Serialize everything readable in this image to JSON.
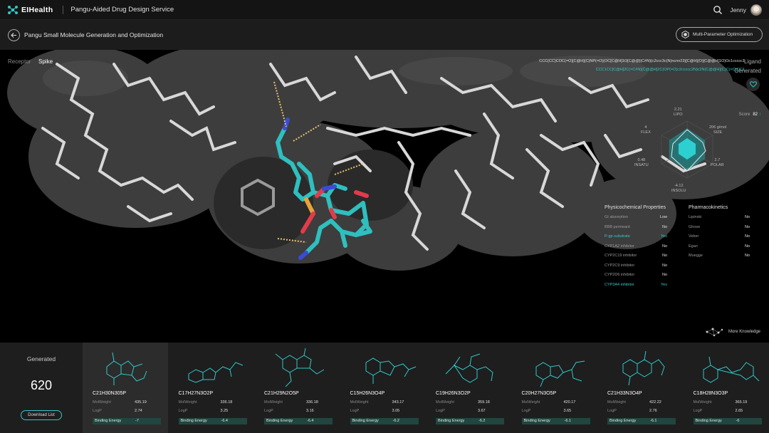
{
  "app": {
    "brand": "EIHealth",
    "service": "Pangu-Aided Drug Design Service",
    "user": "Jenny"
  },
  "header": {
    "title": "Pangu Small Molecule Generation and Optimization",
    "mpo_button": "Multi-Parameter Optimization"
  },
  "viewer": {
    "receptor_label": "Receptor",
    "receptor_value": "Spike",
    "ligand_label": "Ligand",
    "generated_label": "Generated",
    "smiles_ligand": "CCC(CC)COC(=O)[C@H](C)NP(=O)(OC[C@H]1O[C@@](C#N)(c2ccc3c(N)ncnn23)[C@H](O)[C@@H]1O)Oc1ccccc1",
    "smiles_generated": "CCC1CC[C@H]2C(=C#N)[C@@H]2C(OP(=O)c2ccccc2N)c2N(C@@H](C)C)=O)OC1",
    "score_label": "Score",
    "score_value": "82",
    "more_knowledge": "More Knowledge"
  },
  "radar": {
    "lipo": {
      "value": "2.21",
      "label": "LIPO"
    },
    "size": {
      "value": "206 g/mol",
      "label": "SIZE"
    },
    "polar": {
      "value": "2.7",
      "label": "POLAR"
    },
    "insolu": {
      "value": "-4.12",
      "label": "INSOLU"
    },
    "insatu": {
      "value": "0.48",
      "label": "INSATU"
    },
    "flex": {
      "value": "4",
      "label": "FLEX"
    },
    "colors": {
      "accent": "#33c7c7",
      "fill": "#1a8f8f"
    }
  },
  "physicochemical": {
    "title": "Physicochemical Properties",
    "rows": [
      {
        "label": "GI absorption",
        "value": "Low",
        "highlight": false
      },
      {
        "label": "BBB permeant",
        "value": "No",
        "highlight": false
      },
      {
        "label": "P-gp substrate",
        "value": "Yes",
        "highlight": true
      },
      {
        "label": "CYP1A2 inhibitor",
        "value": "No",
        "highlight": false
      },
      {
        "label": "CYP2C19 inhibitor",
        "value": "No",
        "highlight": false
      },
      {
        "label": "CYP2C9 inhibitor",
        "value": "No",
        "highlight": false
      },
      {
        "label": "CYP2D6 inhibitor",
        "value": "No",
        "highlight": false
      },
      {
        "label": "CYP3A4 inhibitor",
        "value": "Yes",
        "highlight": true
      }
    ]
  },
  "pharmacokinetics": {
    "title": "Pharmacokinetics",
    "rows": [
      {
        "label": "Lipinski",
        "value": "No"
      },
      {
        "label": "Ghose",
        "value": "No"
      },
      {
        "label": "Veber",
        "value": "No"
      },
      {
        "label": "Egan",
        "value": "No"
      },
      {
        "label": "Muegge",
        "value": "No"
      }
    ]
  },
  "generated": {
    "title": "Generated",
    "count": "620",
    "download_label": "Download List"
  },
  "card_labels": {
    "molweight": "MolWeight",
    "logp": "LogP",
    "binding": "Binding Energy"
  },
  "molecules": [
    {
      "formula": "C21H30N305P",
      "molweight": "435.19",
      "logp": "2.74",
      "binding": "-7"
    },
    {
      "formula": "C17H27N3O2P",
      "molweight": "336.18",
      "logp": "3.25",
      "binding": "-6.4"
    },
    {
      "formula": "C21H29N2O5P",
      "molweight": "336.18",
      "logp": "3.16",
      "binding": "-6.4"
    },
    {
      "formula": "C15H26N3O4P",
      "molweight": "343.17",
      "logp": "3.05",
      "binding": "-6.2"
    },
    {
      "formula": "C19H26N3O2P",
      "molweight": "359.18",
      "logp": "3.67",
      "binding": "-6.2"
    },
    {
      "formula": "C20H27N3O5P",
      "molweight": "420.17",
      "logp": "3.65",
      "binding": "-6.1"
    },
    {
      "formula": "C21H33N3O4P",
      "molweight": "422.22",
      "logp": "2.76",
      "binding": "-6.1"
    },
    {
      "formula": "C18H28N3O3P",
      "molweight": "365.19",
      "logp": "2.65",
      "binding": "-6"
    }
  ]
}
